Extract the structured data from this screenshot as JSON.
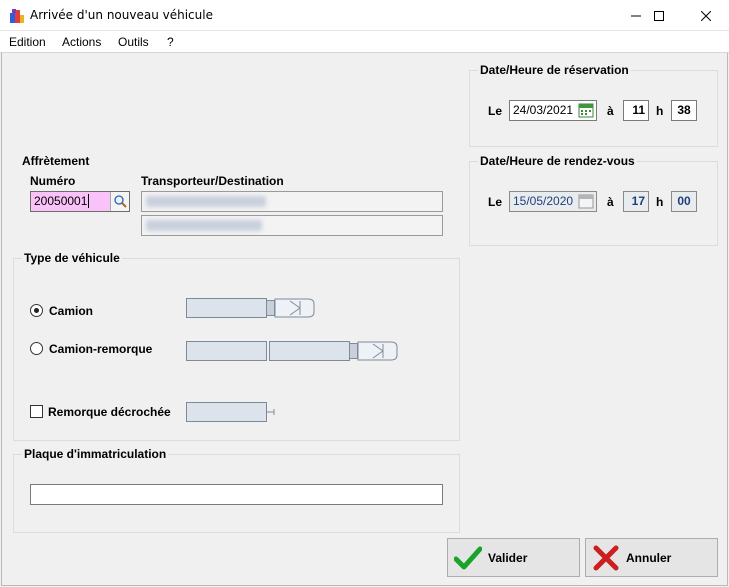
{
  "window": {
    "title": "Arrivée d'un nouveau véhicule"
  },
  "menu": [
    "Edition",
    "Actions",
    "Outils",
    "?"
  ],
  "reservation": {
    "title": "Date/Heure de réservation",
    "le_label": "Le",
    "date": "24/03/2021",
    "a_label": "à",
    "hour": "11",
    "h_label": "h",
    "minute": "38"
  },
  "rendezvous": {
    "title": "Date/Heure de rendez-vous",
    "le_label": "Le",
    "date": "15/05/2020",
    "a_label": "à",
    "hour": "17",
    "h_label": "h",
    "minute": "00"
  },
  "affretement": {
    "title": "Affrètement",
    "numero_label": "Numéro",
    "numero_value": "20050001",
    "transporteur_label": "Transporteur/Destination"
  },
  "vehicle_type": {
    "title": "Type de véhicule",
    "options": [
      {
        "label": "Camion",
        "selected": true
      },
      {
        "label": "Camion-remorque",
        "selected": false
      }
    ],
    "remorque_label": "Remorque décrochée",
    "remorque_checked": false
  },
  "plaque": {
    "title": "Plaque d'immatriculation",
    "value": ""
  },
  "buttons": {
    "valider": "Valider",
    "annuler": "Annuler"
  },
  "colors": {
    "numero_bg": "#f9c3f9",
    "disabled_text": "#223f7a",
    "valider_icon": "#1aa32a",
    "annuler_icon": "#cc1f1f"
  }
}
